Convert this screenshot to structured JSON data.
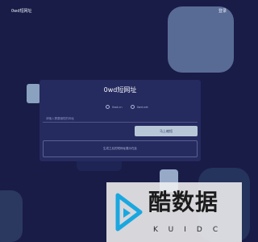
{
  "header": {
    "brand": "0wd短网址",
    "login": "登录"
  },
  "panel": {
    "title": "0wd短网址",
    "radio_options": [
      "0wd.cn",
      "0wd.net"
    ],
    "input_placeholder": "请输入需要缩短的网址",
    "generate_button": "马上缩短",
    "result_placeholder": "生成之后的短网址展示在此"
  },
  "watermark": {
    "cn": "酷数据",
    "en": "KUIDC"
  },
  "colors": {
    "background": "#191c47",
    "panel": "#252a5f",
    "button": "#b7c7d8",
    "accent_shape": "#586b95",
    "logo_blue": "#1aa7e0"
  }
}
